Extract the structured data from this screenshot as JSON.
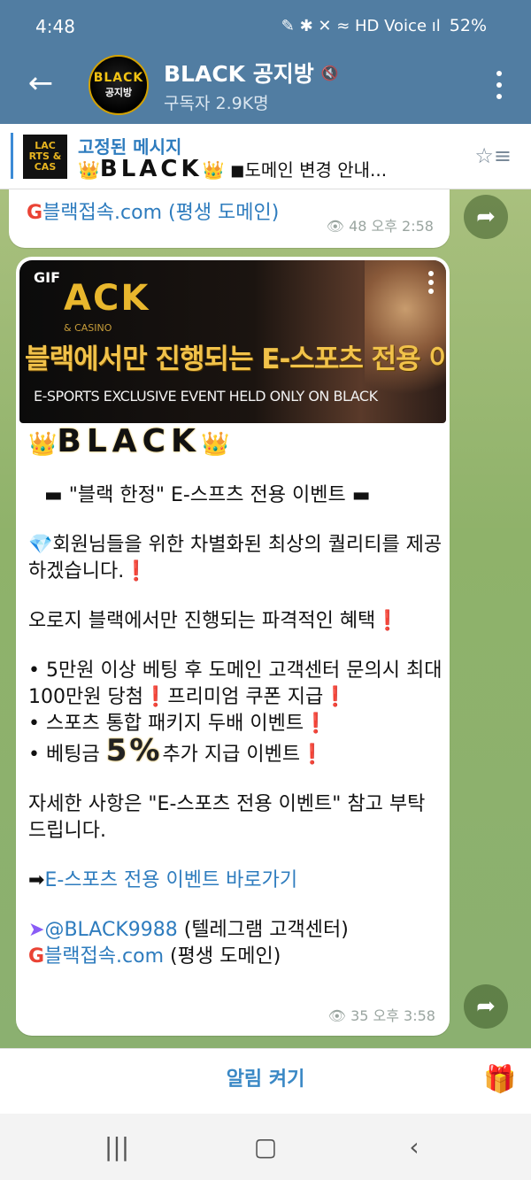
{
  "status_bar": {
    "time": "4:48",
    "indicators": "✎ ✱ ✕ ≈ HD Voice ıl",
    "battery": "52%"
  },
  "header": {
    "title": "BLACK 공지방",
    "subscribers": "구독자 2.9K명",
    "avatar_top": "BLACK",
    "avatar_bottom": "공지방"
  },
  "pinned": {
    "label": "고정된 메시지",
    "thumb_text": "LAC RTS & CAS",
    "preview_crown_left": "👑",
    "preview_brand": "BLACK",
    "preview_crown_right": "👑",
    "preview_text": "◼도메인 변경 안내..."
  },
  "messages": [
    {
      "domain_line": "블랙접속.com (평생 도메인)",
      "views": "48",
      "time": "오후 2:58"
    },
    {
      "gif_badge": "GIF",
      "gif_logo": "ACK",
      "gif_logo_sub": "& CASINO",
      "gif_korean": "블랙에서만 진행되는 E-스포츠 전용 이벤트",
      "gif_english": "E-SPORTS EXCLUSIVE EVENT HELD ONLY ON BLACK",
      "brand": "BLACK",
      "crown": "👑",
      "headline": "▬ \"블랙 한정\" E-스프츠 전용 이벤트 ▬",
      "intro_1": "💎회원님들을 위한 차별화된 최상의 퀄리티를 제공하겠습니다.",
      "exclaim": "❗",
      "intro_2": "오로지 블랙에서만 진행되는 파격적인 혜택",
      "item_1": "• 5만원 이상 베팅 후 도메인 고객센터 문의시 최대 100만원 당첨",
      "item_1b": "프리미엄 쿠폰 지급",
      "item_2": "• 스포츠 통합 패키지 두배 이벤트",
      "item_3a": "• 베팅금",
      "item_3_pct": "5%",
      "item_3b": "추가 지급 이벤트",
      "outro": "자세한 사항은 \"E-스포츠 전용 이벤트\" 참고 부탁드립니다.",
      "arrow": "➡",
      "event_link": "E-스포츠 전용 이벤트 바로가기",
      "telegram_handle": "@BLACK9988",
      "telegram_label": "(텔레그램 고객센터)",
      "domain_link": "블랙접속.com",
      "domain_label": "(평생 도메인)",
      "views": "35",
      "time": "오후 3:58"
    }
  ],
  "bottom": {
    "notify_label": "알림 켜기"
  },
  "icons": {
    "back": "back-arrow-icon",
    "more": "more-vertical-icon",
    "share": "share-icon",
    "gift": "gift-icon",
    "views": "eye-icon"
  }
}
